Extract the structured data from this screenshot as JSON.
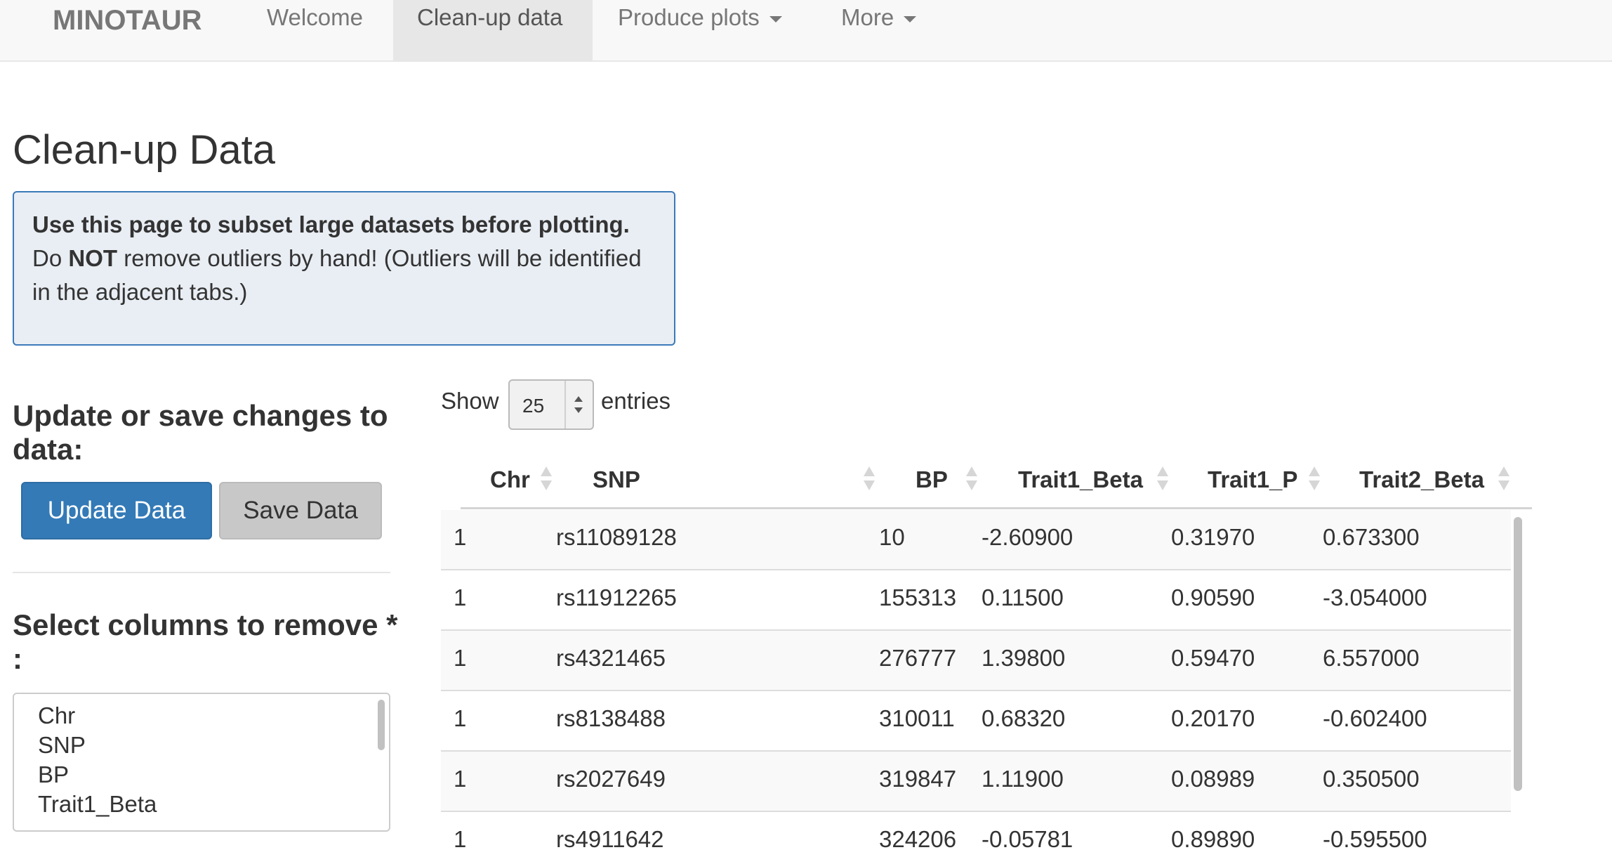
{
  "navbar": {
    "brand": "MINOTAUR",
    "items": [
      {
        "label": "Welcome"
      },
      {
        "label": "Clean-up data"
      },
      {
        "label": "Produce plots"
      },
      {
        "label": "More"
      }
    ]
  },
  "page": {
    "title": "Clean-up Data",
    "info": {
      "line1": "Use this page to subset large datasets before plotting.",
      "do": "Do",
      "not": "NOT",
      "rest": "remove outliers by hand! (Outliers will be identified in the adjacent tabs.)"
    }
  },
  "sidebar": {
    "update_heading": "Update or save changes to data:",
    "update_button": "Update Data",
    "save_button": "Save Data",
    "remove_heading": "Select columns to remove * :",
    "column_options": [
      "Chr",
      "SNP",
      "BP",
      "Trait1_Beta"
    ]
  },
  "table": {
    "show_label": "Show",
    "entries_label": "entries",
    "page_length": "25",
    "columns": [
      "Chr",
      "SNP",
      "BP",
      "Trait1_Beta",
      "Trait1_P",
      "Trait2_Beta"
    ],
    "rows": [
      [
        "1",
        "rs11089128",
        "10",
        "-2.60900",
        "0.31970",
        "0.673300"
      ],
      [
        "1",
        "rs11912265",
        "155313",
        "0.11500",
        "0.90590",
        "-3.054000"
      ],
      [
        "1",
        "rs4321465",
        "276777",
        "1.39800",
        "0.59470",
        "6.557000"
      ],
      [
        "1",
        "rs8138488",
        "310011",
        "0.68320",
        "0.20170",
        "-0.602400"
      ],
      [
        "1",
        "rs2027649",
        "319847",
        "1.11900",
        "0.08989",
        "0.350500"
      ],
      [
        "1",
        "rs4911642",
        "324206",
        "-0.05781",
        "0.89890",
        "-0.595500"
      ]
    ]
  }
}
